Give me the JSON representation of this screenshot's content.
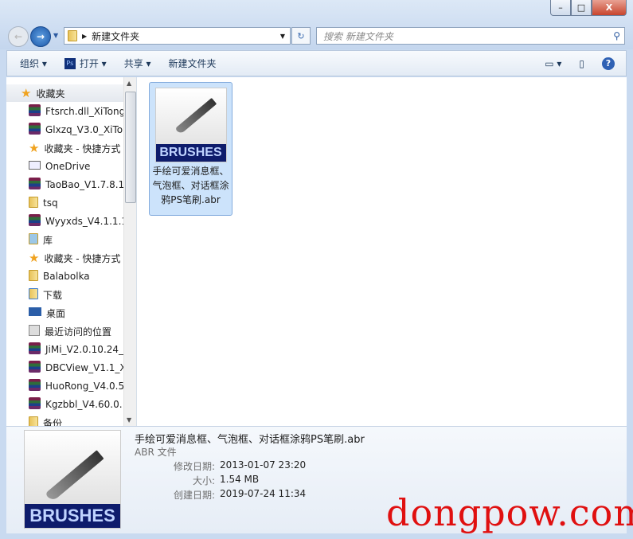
{
  "window": {
    "minimize": "–",
    "maximize": "□",
    "close": "X"
  },
  "address": {
    "path": "新建文件夹",
    "refresh": "↻"
  },
  "search": {
    "placeholder": "搜索 新建文件夹"
  },
  "toolbar": {
    "organize": "组织 ▾",
    "open": "打开 ▾",
    "share": "共享 ▾",
    "new_folder": "新建文件夹",
    "ps_badge": "Ps"
  },
  "nav": {
    "items": [
      {
        "label": "收藏夹",
        "icon": "star"
      },
      {
        "label": "Ftsrch.dll_XiTong",
        "icon": "rar"
      },
      {
        "label": "Glxzq_V3.0_XiTo",
        "icon": "rar"
      },
      {
        "label": "收藏夹 - 快捷方式",
        "icon": "star"
      },
      {
        "label": "OneDrive",
        "icon": "onedrive"
      },
      {
        "label": "TaoBao_V1.7.8.1",
        "icon": "rar"
      },
      {
        "label": "tsq",
        "icon": "folder"
      },
      {
        "label": "Wyyxds_V4.1.1.1",
        "icon": "rar"
      },
      {
        "label": "库",
        "icon": "library"
      },
      {
        "label": "收藏夹 - 快捷方式",
        "icon": "star"
      },
      {
        "label": "Balabolka",
        "icon": "folder"
      },
      {
        "label": "下载",
        "icon": "download-folder"
      },
      {
        "label": "桌面",
        "icon": "desktop"
      },
      {
        "label": "最近访问的位置",
        "icon": "recent"
      },
      {
        "label": "JiMi_V2.0.10.24_",
        "icon": "rar"
      },
      {
        "label": "DBCView_V1.1_X",
        "icon": "rar"
      },
      {
        "label": "HuoRong_V4.0.5",
        "icon": "rar"
      },
      {
        "label": "Kgzbbl_V4.60.0.",
        "icon": "rar"
      },
      {
        "label": "备份",
        "icon": "folder"
      }
    ]
  },
  "file": {
    "name": "手绘可爱消息框、气泡框、对话框涂鸦PS笔刷.abr",
    "thumb_text": "BRUSHES"
  },
  "details": {
    "title": "手绘可爱消息框、气泡框、对话框涂鸦PS笔刷.abr",
    "type": "ABR 文件",
    "modified_label": "修改日期:",
    "modified": "2013-01-07 23:20",
    "size_label": "大小:",
    "size": "1.54 MB",
    "created_label": "创建日期:",
    "created": "2019-07-24 11:34"
  },
  "watermark": "dongpow.com"
}
